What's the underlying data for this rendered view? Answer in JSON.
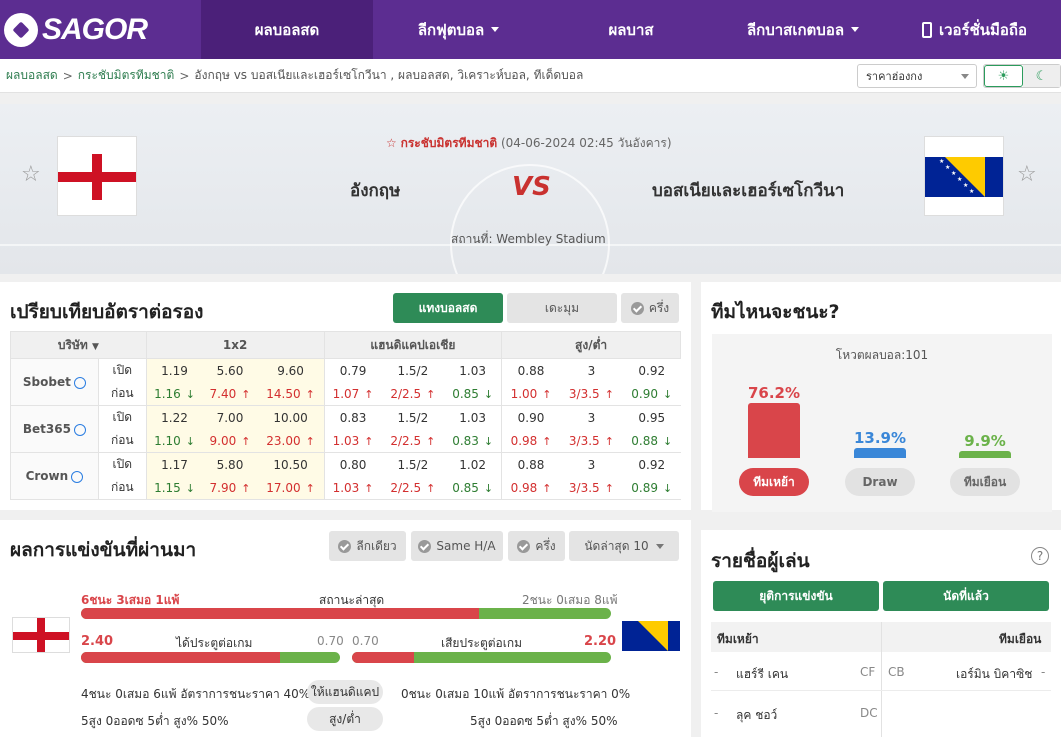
{
  "nav": {
    "logo": "SAGOR",
    "items": [
      {
        "label": "ผลบอลสด",
        "active": true,
        "caret": false
      },
      {
        "label": "ลีกฟุตบอล",
        "active": false,
        "caret": true
      },
      {
        "label": "ผลบาส",
        "active": false,
        "caret": false
      },
      {
        "label": "ลีกบาสเกตบอล",
        "active": false,
        "caret": true
      },
      {
        "label": "เวอร์ชั่นมือถือ",
        "active": false,
        "caret": false
      }
    ]
  },
  "breadcrumb": {
    "home": "ผลบอลสด",
    "section": "กระชับมิตรทีมชาติ",
    "current": "อังกฤษ vs  บอสเนียและเฮอร์เซโกวีนา ,  ผลบอลสด,  วิเคราะห์บอล,  ทีเด็ดบอล"
  },
  "odds_select": "ราคาฮ่องกง",
  "match": {
    "competition": "กระชับมิตรทีมชาติ",
    "datetime": "(04-06-2024 02:45 วันอังคาร)",
    "home": "อังกฤษ",
    "away": "บอสเนียและเฮอร์เซโกวีนา",
    "vs": "VS",
    "venue": "สถานที่: Wembley Stadium"
  },
  "odds": {
    "title": "เปรียบเทียบอัตราต่อรอง",
    "buttons": [
      "แทงบอลสด",
      "เดะมุม",
      "ครึ่ง"
    ],
    "headers": {
      "company": "บริษัท",
      "h1": "1x2",
      "h2": "แฮนดิแคปเอเชีย",
      "h3": "สูง/ต่ำ"
    },
    "open_label": "เปิด",
    "prev_label": "ก่อน",
    "rows": [
      {
        "company": "Sbobet",
        "open": [
          "1.19",
          "5.60",
          "9.60",
          "0.79",
          "1.5/2",
          "1.03",
          "0.88",
          "3",
          "0.92"
        ],
        "prev": [
          [
            "1.16",
            "dn"
          ],
          [
            "7.40",
            "up"
          ],
          [
            "14.50",
            "up"
          ],
          [
            "1.07",
            "up"
          ],
          [
            "2/2.5",
            "up"
          ],
          [
            "0.85",
            "dn"
          ],
          [
            "1.00",
            "up"
          ],
          [
            "3/3.5",
            "up"
          ],
          [
            "0.90",
            "dn"
          ]
        ]
      },
      {
        "company": "Bet365",
        "open": [
          "1.22",
          "7.00",
          "10.00",
          "0.83",
          "1.5/2",
          "1.03",
          "0.90",
          "3",
          "0.95"
        ],
        "prev": [
          [
            "1.10",
            "dn"
          ],
          [
            "9.00",
            "up"
          ],
          [
            "23.00",
            "up"
          ],
          [
            "1.03",
            "up"
          ],
          [
            "2/2.5",
            "up"
          ],
          [
            "0.83",
            "dn"
          ],
          [
            "0.98",
            "up"
          ],
          [
            "3/3.5",
            "up"
          ],
          [
            "0.88",
            "dn"
          ]
        ]
      },
      {
        "company": "Crown",
        "open": [
          "1.17",
          "5.80",
          "10.50",
          "0.80",
          "1.5/2",
          "1.02",
          "0.88",
          "3",
          "0.92"
        ],
        "prev": [
          [
            "1.15",
            "dn"
          ],
          [
            "7.90",
            "up"
          ],
          [
            "17.00",
            "up"
          ],
          [
            "1.03",
            "up"
          ],
          [
            "2/2.5",
            "up"
          ],
          [
            "0.85",
            "dn"
          ],
          [
            "0.98",
            "up"
          ],
          [
            "3/3.5",
            "up"
          ],
          [
            "0.89",
            "dn"
          ]
        ]
      }
    ]
  },
  "prediction": {
    "title": "ทีมไหนจะชนะ?",
    "votes": "โหวตผลบอล:101",
    "home": {
      "pct": "76.2%",
      "value": 76.2,
      "label": "ทีมเหย้า",
      "color": "#d9454a"
    },
    "draw": {
      "pct": "13.9%",
      "value": 13.9,
      "label": "Draw",
      "color": "#3a87d8"
    },
    "away": {
      "pct": "9.9%",
      "value": 9.9,
      "label": "ทีมเยือน",
      "color": "#6bb24a"
    }
  },
  "results": {
    "title": "ผลการแข่งขันที่ผ่านมา",
    "filters": [
      "ลีกเดียว",
      "Same H/A",
      "ครึ่ง"
    ],
    "select": "นัดล่าสุด 10",
    "home_form": "6ชนะ 3เสมอ 1แพ้",
    "form_label": "สถานะล่าสุด",
    "away_form": "2ชนะ 0เสมอ 8แพ้",
    "form_win_fraction": 0.75,
    "home_scored": "2.40",
    "scored_label": "ได้ประตูต่อเกม",
    "home_scored_other": "0.70",
    "away_conceded_other": "0.70",
    "conceded_label": "เสียประตูต่อเกม",
    "away_conceded": "2.20",
    "home_scored_fraction": 0.77,
    "away_conceded_fraction": 0.24,
    "home_hc": "4ชนะ 0เสมอ 6แพ้ อัตราการชนะราคา 40%",
    "hc_label": "ให้แฮนดิแคป",
    "away_hc": "0ชนะ 0เสมอ 10แพ้ อัตราการชนะราคา 0%",
    "home_ou": "5สูง 0ออดซ 5ต่ำ สูง% 50%",
    "ou_label": "สูง/ต่ำ",
    "away_ou": "5สูง 0ออดซ 5ต่ำ สูง% 50%"
  },
  "players": {
    "title": "รายชื่อผู้เล่น",
    "help": "?",
    "buttons": [
      "ยุติการแข่งขัน",
      "นัดที่แล้ว"
    ],
    "home_header": "ทีมเหย้า",
    "away_header": "ทีมเยือน",
    "home": [
      {
        "dash": "-",
        "name": "แฮร์รี เคน",
        "pos": "CF"
      },
      {
        "dash": "-",
        "name": "ลุค ชอว์",
        "pos": "DC"
      }
    ],
    "away": [
      {
        "pos": "CB",
        "name": "เอร์มิน บิคาซิช",
        "dash": "-"
      }
    ]
  }
}
